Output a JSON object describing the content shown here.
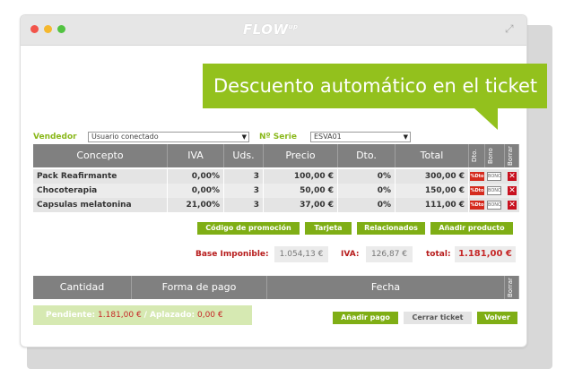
{
  "app": {
    "logo": "FLOW",
    "logo_sup": "up"
  },
  "callout": {
    "text": "Descuento automático en el ticket",
    "color": "#93c11d"
  },
  "filters": {
    "vendedor_label": "Vendedor",
    "vendedor_value": "Usuario conectado",
    "serie_label": "Nº Serie",
    "serie_value": "ESVA01"
  },
  "table": {
    "headers": {
      "concepto": "Concepto",
      "iva": "IVA",
      "uds": "Uds.",
      "precio": "Precio",
      "dto": "Dto.",
      "total": "Total",
      "dto_col": "Dto.",
      "bono_col": "Bono",
      "borrar_col": "Borrar"
    },
    "rows": [
      {
        "concepto": "Pack Reafirmante",
        "iva": "0,00%",
        "uds": "3",
        "precio": "100,00 €",
        "dto": "0%",
        "total": "300,00 €"
      },
      {
        "concepto": "Chocoterapia",
        "iva": "0,00%",
        "uds": "3",
        "precio": "50,00 €",
        "dto": "0%",
        "total": "150,00 €"
      },
      {
        "concepto": "Capsulas melatonina",
        "iva": "21,00%",
        "uds": "3",
        "precio": "37,00 €",
        "dto": "0%",
        "total": "111,00 €"
      }
    ],
    "dto_badge": "%Dto",
    "bono_badge": "BONO",
    "delete_glyph": "✕"
  },
  "actions": {
    "promo": "Código de promoción",
    "tarjeta": "Tarjeta",
    "relacionados": "Relacionados",
    "add_product": "Añadir producto"
  },
  "totals": {
    "base_label": "Base Imponible:",
    "base_value": "1.054,13 €",
    "iva_label": "IVA:",
    "iva_value": "126,87 €",
    "total_label": "total:",
    "total_value": "1.181,00 €"
  },
  "payments": {
    "headers": {
      "cantidad": "Cantidad",
      "forma": "Forma de pago",
      "fecha": "Fecha",
      "borrar": "Borrar"
    },
    "pendiente_label": "Pendiente:",
    "pendiente_value": "1.181,00 €",
    "aplazado_label": "/ Aplazado:",
    "aplazado_value": "0,00 €",
    "add_payment": "Añadir pago",
    "close_ticket": "Cerrar ticket",
    "back": "Volver"
  }
}
